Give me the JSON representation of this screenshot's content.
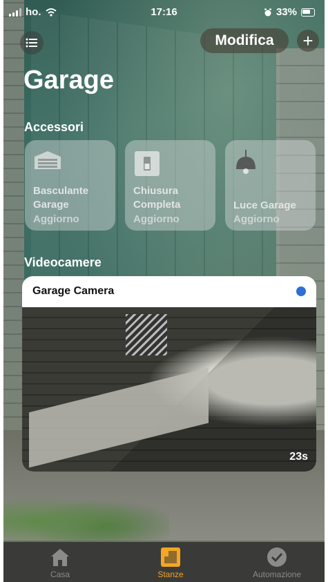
{
  "status_bar": {
    "carrier": "ho.",
    "time": "17:16",
    "battery": "33%"
  },
  "header": {
    "edit_label": "Modifica",
    "add_label": "+",
    "title": "Garage"
  },
  "accessories": {
    "section_title": "Accessori",
    "items": [
      {
        "name": "Basculante Garage",
        "state": "Aggiorno",
        "icon": "garage-door-icon"
      },
      {
        "name": "Chiusura Completa",
        "state": "Aggiorno",
        "icon": "switch-icon"
      },
      {
        "name": "Luce Garage",
        "state": "Aggiorno",
        "icon": "pendant-lamp-icon"
      }
    ]
  },
  "cameras": {
    "section_title": "Videocamere",
    "items": [
      {
        "name": "Garage Camera",
        "timer": "23s",
        "status_color": "#2f6fd6"
      }
    ]
  },
  "tabbar": {
    "tabs": [
      {
        "label": "Casa",
        "icon": "house-icon",
        "active": false
      },
      {
        "label": "Stanze",
        "icon": "rooms-icon",
        "active": true
      },
      {
        "label": "Automazione",
        "icon": "clock-check-icon",
        "active": false
      }
    ]
  },
  "colors": {
    "accent": "#f5a623",
    "camera_dot": "#2f6fd6"
  }
}
